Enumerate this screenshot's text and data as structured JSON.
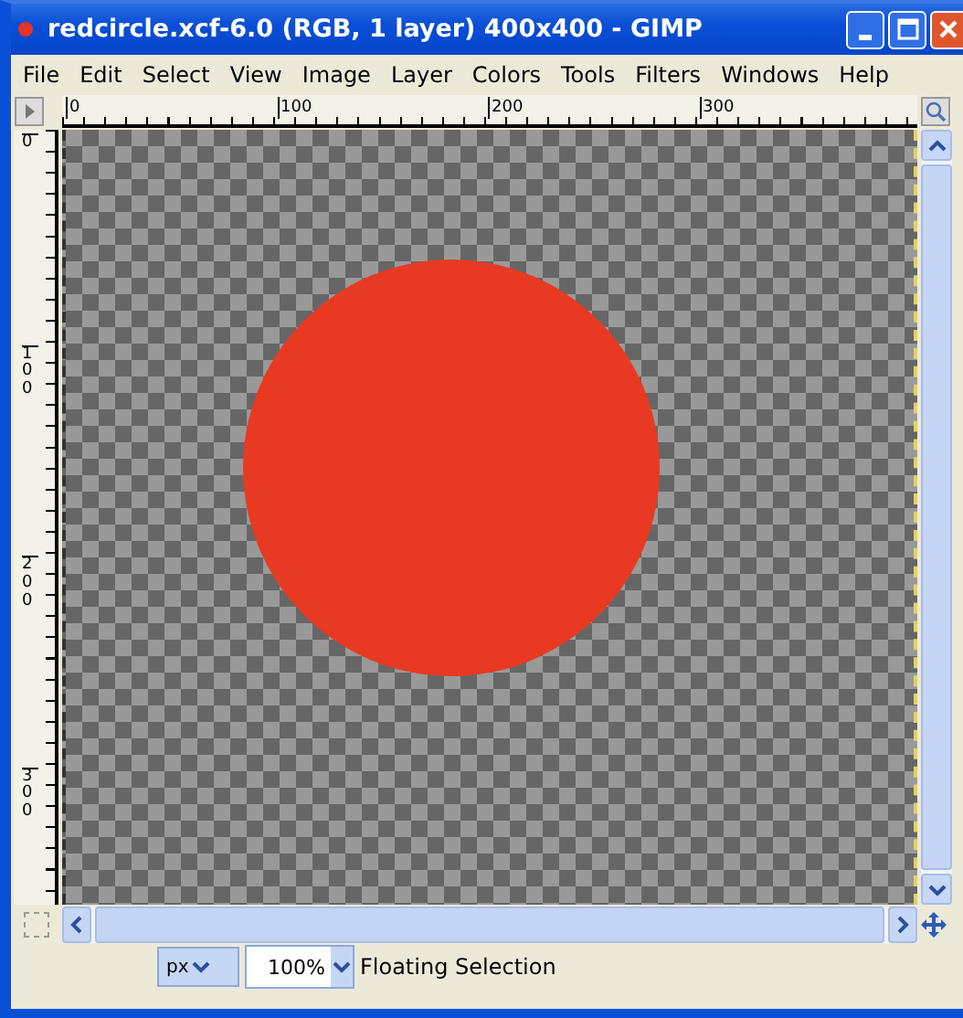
{
  "window": {
    "title": "redcircle.xcf-6.0 (RGB, 1 layer) 400x400 - GIMP"
  },
  "menu": [
    {
      "label": "File"
    },
    {
      "label": "Edit"
    },
    {
      "label": "Select"
    },
    {
      "label": "View"
    },
    {
      "label": "Image"
    },
    {
      "label": "Layer"
    },
    {
      "label": "Colors"
    },
    {
      "label": "Tools"
    },
    {
      "label": "Filters"
    },
    {
      "label": "Windows"
    },
    {
      "label": "Help"
    }
  ],
  "rulers": {
    "horizontal": [
      "0",
      "100",
      "200",
      "300"
    ],
    "vertical": [
      "0",
      "100",
      "200",
      "300"
    ]
  },
  "status_bar": {
    "unit": "px",
    "zoom": "100%",
    "message": "Floating Selection"
  }
}
